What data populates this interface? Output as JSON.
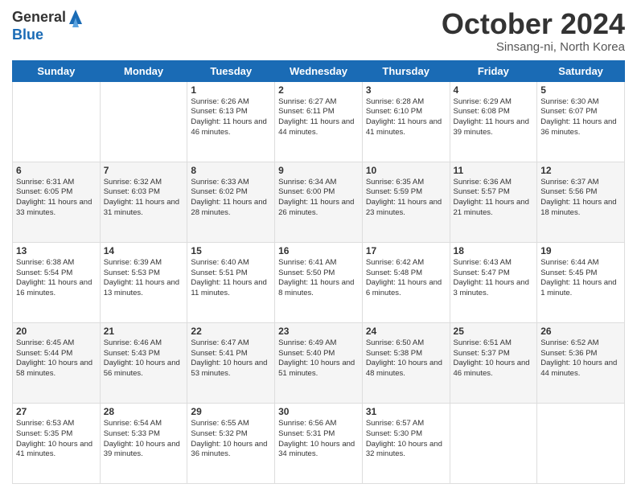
{
  "logo": {
    "general": "General",
    "blue": "Blue"
  },
  "title": "October 2024",
  "subtitle": "Sinsang-ni, North Korea",
  "days_of_week": [
    "Sunday",
    "Monday",
    "Tuesday",
    "Wednesday",
    "Thursday",
    "Friday",
    "Saturday"
  ],
  "weeks": [
    [
      {
        "day": "",
        "info": ""
      },
      {
        "day": "",
        "info": ""
      },
      {
        "day": "1",
        "info": "Sunrise: 6:26 AM\nSunset: 6:13 PM\nDaylight: 11 hours and 46 minutes."
      },
      {
        "day": "2",
        "info": "Sunrise: 6:27 AM\nSunset: 6:11 PM\nDaylight: 11 hours and 44 minutes."
      },
      {
        "day": "3",
        "info": "Sunrise: 6:28 AM\nSunset: 6:10 PM\nDaylight: 11 hours and 41 minutes."
      },
      {
        "day": "4",
        "info": "Sunrise: 6:29 AM\nSunset: 6:08 PM\nDaylight: 11 hours and 39 minutes."
      },
      {
        "day": "5",
        "info": "Sunrise: 6:30 AM\nSunset: 6:07 PM\nDaylight: 11 hours and 36 minutes."
      }
    ],
    [
      {
        "day": "6",
        "info": "Sunrise: 6:31 AM\nSunset: 6:05 PM\nDaylight: 11 hours and 33 minutes."
      },
      {
        "day": "7",
        "info": "Sunrise: 6:32 AM\nSunset: 6:03 PM\nDaylight: 11 hours and 31 minutes."
      },
      {
        "day": "8",
        "info": "Sunrise: 6:33 AM\nSunset: 6:02 PM\nDaylight: 11 hours and 28 minutes."
      },
      {
        "day": "9",
        "info": "Sunrise: 6:34 AM\nSunset: 6:00 PM\nDaylight: 11 hours and 26 minutes."
      },
      {
        "day": "10",
        "info": "Sunrise: 6:35 AM\nSunset: 5:59 PM\nDaylight: 11 hours and 23 minutes."
      },
      {
        "day": "11",
        "info": "Sunrise: 6:36 AM\nSunset: 5:57 PM\nDaylight: 11 hours and 21 minutes."
      },
      {
        "day": "12",
        "info": "Sunrise: 6:37 AM\nSunset: 5:56 PM\nDaylight: 11 hours and 18 minutes."
      }
    ],
    [
      {
        "day": "13",
        "info": "Sunrise: 6:38 AM\nSunset: 5:54 PM\nDaylight: 11 hours and 16 minutes."
      },
      {
        "day": "14",
        "info": "Sunrise: 6:39 AM\nSunset: 5:53 PM\nDaylight: 11 hours and 13 minutes."
      },
      {
        "day": "15",
        "info": "Sunrise: 6:40 AM\nSunset: 5:51 PM\nDaylight: 11 hours and 11 minutes."
      },
      {
        "day": "16",
        "info": "Sunrise: 6:41 AM\nSunset: 5:50 PM\nDaylight: 11 hours and 8 minutes."
      },
      {
        "day": "17",
        "info": "Sunrise: 6:42 AM\nSunset: 5:48 PM\nDaylight: 11 hours and 6 minutes."
      },
      {
        "day": "18",
        "info": "Sunrise: 6:43 AM\nSunset: 5:47 PM\nDaylight: 11 hours and 3 minutes."
      },
      {
        "day": "19",
        "info": "Sunrise: 6:44 AM\nSunset: 5:45 PM\nDaylight: 11 hours and 1 minute."
      }
    ],
    [
      {
        "day": "20",
        "info": "Sunrise: 6:45 AM\nSunset: 5:44 PM\nDaylight: 10 hours and 58 minutes."
      },
      {
        "day": "21",
        "info": "Sunrise: 6:46 AM\nSunset: 5:43 PM\nDaylight: 10 hours and 56 minutes."
      },
      {
        "day": "22",
        "info": "Sunrise: 6:47 AM\nSunset: 5:41 PM\nDaylight: 10 hours and 53 minutes."
      },
      {
        "day": "23",
        "info": "Sunrise: 6:49 AM\nSunset: 5:40 PM\nDaylight: 10 hours and 51 minutes."
      },
      {
        "day": "24",
        "info": "Sunrise: 6:50 AM\nSunset: 5:38 PM\nDaylight: 10 hours and 48 minutes."
      },
      {
        "day": "25",
        "info": "Sunrise: 6:51 AM\nSunset: 5:37 PM\nDaylight: 10 hours and 46 minutes."
      },
      {
        "day": "26",
        "info": "Sunrise: 6:52 AM\nSunset: 5:36 PM\nDaylight: 10 hours and 44 minutes."
      }
    ],
    [
      {
        "day": "27",
        "info": "Sunrise: 6:53 AM\nSunset: 5:35 PM\nDaylight: 10 hours and 41 minutes."
      },
      {
        "day": "28",
        "info": "Sunrise: 6:54 AM\nSunset: 5:33 PM\nDaylight: 10 hours and 39 minutes."
      },
      {
        "day": "29",
        "info": "Sunrise: 6:55 AM\nSunset: 5:32 PM\nDaylight: 10 hours and 36 minutes."
      },
      {
        "day": "30",
        "info": "Sunrise: 6:56 AM\nSunset: 5:31 PM\nDaylight: 10 hours and 34 minutes."
      },
      {
        "day": "31",
        "info": "Sunrise: 6:57 AM\nSunset: 5:30 PM\nDaylight: 10 hours and 32 minutes."
      },
      {
        "day": "",
        "info": ""
      },
      {
        "day": "",
        "info": ""
      }
    ]
  ]
}
